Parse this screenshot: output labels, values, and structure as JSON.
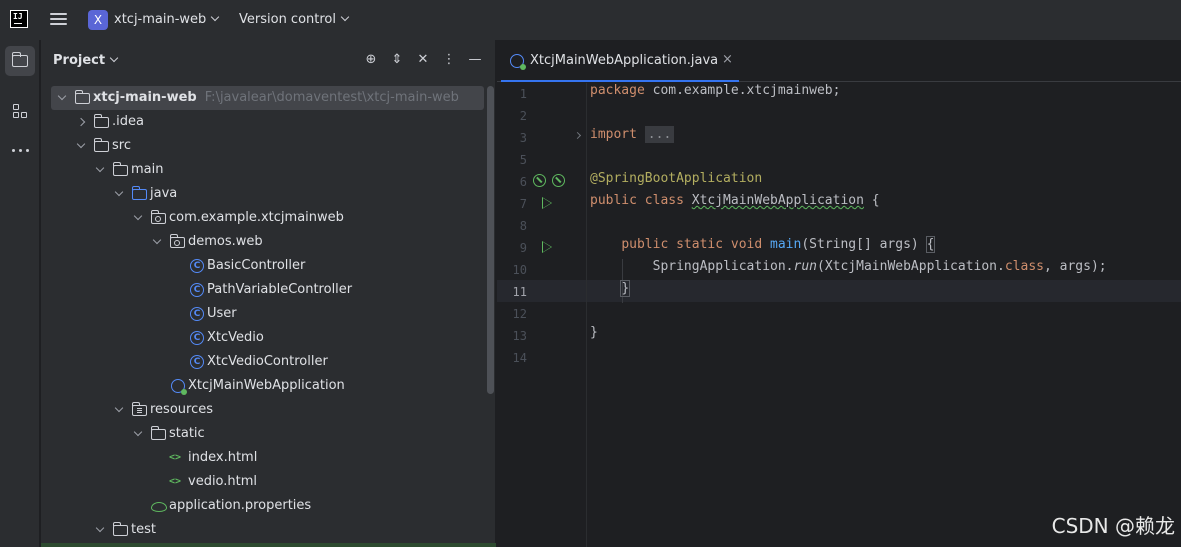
{
  "titlebar": {
    "logo_text": "IJ",
    "project_badge": "X",
    "project_name": "xtcj-main-web",
    "vcs_label": "Version control"
  },
  "project_panel": {
    "title": "Project",
    "tree": [
      {
        "label": "xtcj-main-web",
        "path": "F:\\javalear\\domaventest\\xtcj-main-web"
      },
      {
        "label": ".idea"
      },
      {
        "label": "src"
      },
      {
        "label": "main"
      },
      {
        "label": "java"
      },
      {
        "label": "com.example.xtcjmainweb"
      },
      {
        "label": "demos.web"
      },
      {
        "label": "BasicController"
      },
      {
        "label": "PathVariableController"
      },
      {
        "label": "User"
      },
      {
        "label": "XtcVedio"
      },
      {
        "label": "XtcVedioController"
      },
      {
        "label": "XtcjMainWebApplication"
      },
      {
        "label": "resources"
      },
      {
        "label": "static"
      },
      {
        "label": "index.html"
      },
      {
        "label": "vedio.html"
      },
      {
        "label": "application.properties"
      },
      {
        "label": "test"
      }
    ]
  },
  "editor": {
    "tab_label": "XtcjMainWebApplication.java",
    "tab_close": "×",
    "line_numbers": [
      "1",
      "2",
      "3",
      "5",
      "6",
      "7",
      "8",
      "9",
      "10",
      "11",
      "12",
      "13",
      "14"
    ],
    "current_line": "11",
    "code": {
      "l1_kw": "package",
      "l1_rest": " com.example.xtcjmainweb;",
      "l3_kw": "import",
      "l3_fold": "...",
      "l6_ann": "@SpringBootApplication",
      "l7_kw": "public class",
      "l7_name": "XtcjMainWebApplication",
      "l7_rest": " {",
      "l9_kw": "public static void",
      "l9_fn": "main",
      "l9_rest": "(String[] args) ",
      "l9_brace": "{",
      "l10_pre": "SpringApplication.",
      "l10_run": "run",
      "l10_mid": "(XtcjMainWebApplication.",
      "l10_kw": "class",
      "l10_end": ", args);",
      "l11_brace": "}",
      "l13": "}"
    }
  },
  "watermark": "CSDN @赖龙"
}
